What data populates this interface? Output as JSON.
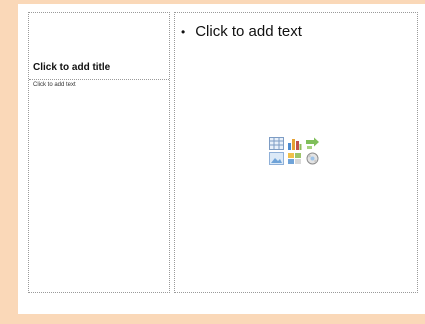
{
  "slide": {
    "title_placeholder": "Click to add title",
    "left_body_placeholder": "Click to add text",
    "right_body_bullet": "•",
    "right_body_placeholder": "Click to add text"
  },
  "content_icons": [
    "insert-table-icon",
    "insert-chart-icon",
    "insert-smartart-icon",
    "insert-picture-icon",
    "insert-clipart-icon",
    "insert-media-icon"
  ]
}
